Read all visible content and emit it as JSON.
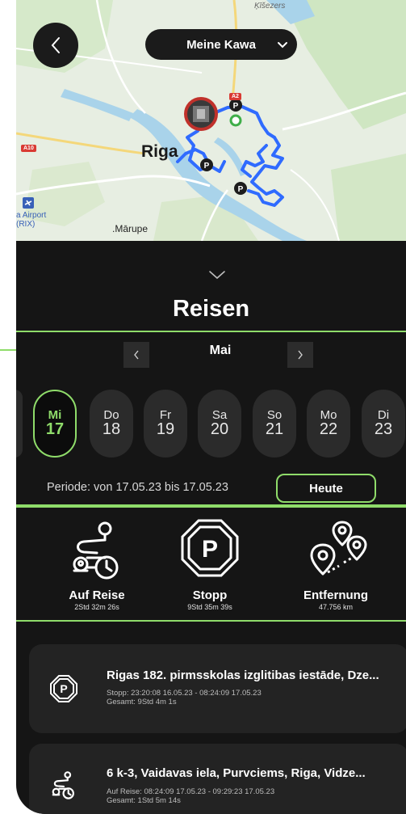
{
  "header": {
    "vehicle_name": "Meine Kawa"
  },
  "map": {
    "city_label": "Riga",
    "places": {
      "marupe": ".Mārupe",
      "kiseze": "Ķīšezers",
      "airport": "a Airport (RIX)"
    },
    "roads": [
      "A10",
      "A2"
    ],
    "route_color": "#2f6bff",
    "marker_label": "P"
  },
  "panel": {
    "title": "Reisen",
    "month": "Mai",
    "days": [
      {
        "name": "Mi",
        "date": "17",
        "selected": true
      },
      {
        "name": "Do",
        "date": "18",
        "selected": false
      },
      {
        "name": "Fr",
        "date": "19",
        "selected": false
      },
      {
        "name": "Sa",
        "date": "20",
        "selected": false
      },
      {
        "name": "So",
        "date": "21",
        "selected": false
      },
      {
        "name": "Mo",
        "date": "22",
        "selected": false
      },
      {
        "name": "Di",
        "date": "23",
        "selected": false
      }
    ],
    "period": "Periode: von 17.05.23 bis 17.05.23",
    "today_button": "Heute"
  },
  "stats": [
    {
      "label": "Auf Reise",
      "value": "2Std 32m 26s",
      "icon": "trip-route-clock-icon"
    },
    {
      "label": "Stopp",
      "value": "9Std 35m 39s",
      "icon": "parking-stop-icon"
    },
    {
      "label": "Entfernung",
      "value": "47.756 km",
      "icon": "distance-pins-icon"
    }
  ],
  "trips": [
    {
      "icon": "parking-stop-icon",
      "title": "Rigas 182. pirmsskolas izglitibas iestāde, Dze...",
      "line1": "Stopp: 23:20:08 16.05.23 - 08:24:09 17.05.23",
      "line2": "Gesamt: 9Std 4m 1s"
    },
    {
      "icon": "trip-route-clock-icon",
      "title": "6 k-3, Vaidavas iela, Purvciems, Riga, Vidze...",
      "line1": "Auf Reise: 08:24:09 17.05.23 - 09:29:23 17.05.23",
      "line2": "Gesamt: 1Std 5m 14s"
    }
  ],
  "colors": {
    "accent": "#8fdc6a",
    "background": "#151515",
    "card": "#232323"
  }
}
